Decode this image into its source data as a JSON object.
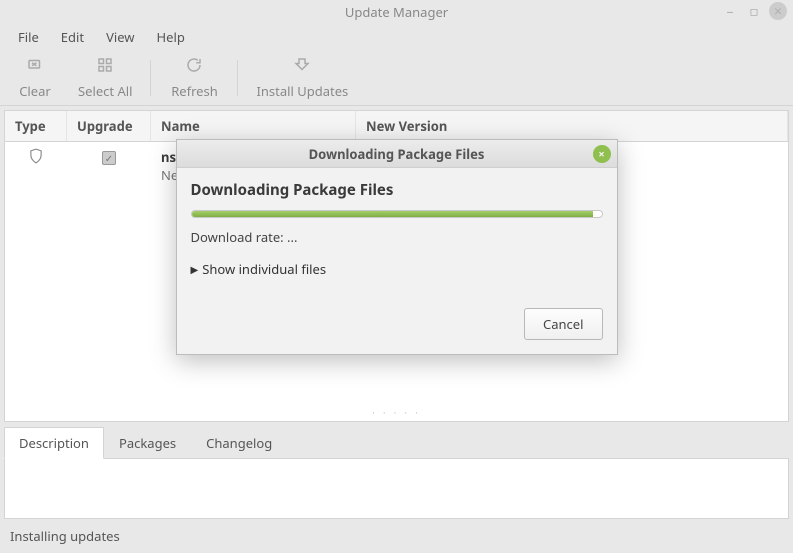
{
  "window": {
    "title": "Update Manager"
  },
  "menu": {
    "file": "File",
    "edit": "Edit",
    "view": "View",
    "help": "Help"
  },
  "toolbar": {
    "clear": "Clear",
    "select_all": "Select All",
    "refresh": "Refresh",
    "install": "Install Updates"
  },
  "table": {
    "headers": {
      "type": "Type",
      "upgrade": "Upgrade",
      "name": "Name",
      "newver": "New Version"
    },
    "rows": [
      {
        "name_line1": "ns",
        "name_line2": "Ne"
      }
    ]
  },
  "tabs": {
    "description": "Description",
    "packages": "Packages",
    "changelog": "Changelog"
  },
  "status": "Installing updates",
  "dialog": {
    "title": "Downloading Package Files",
    "heading": "Downloading Package Files",
    "rate_label": "Download rate: ...",
    "expand_label": "Show individual files",
    "cancel": "Cancel"
  }
}
